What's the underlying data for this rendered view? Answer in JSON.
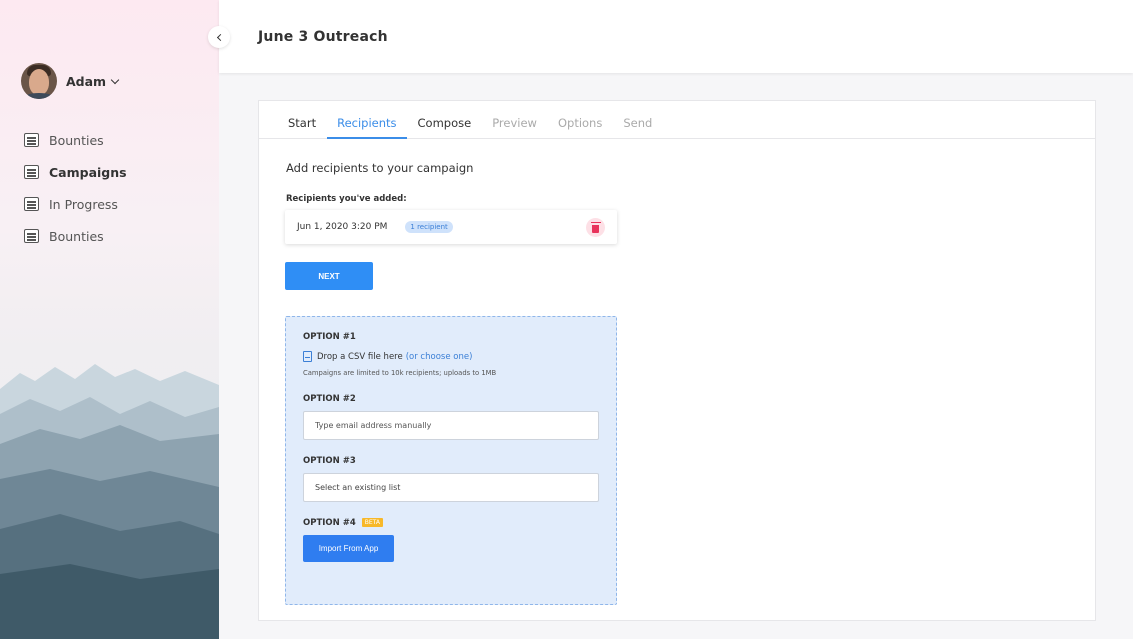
{
  "user": {
    "name": "Adam"
  },
  "sidebar": {
    "items": [
      {
        "label": "Bounties",
        "active": false
      },
      {
        "label": "Campaigns",
        "active": true
      },
      {
        "label": "In Progress",
        "active": false
      },
      {
        "label": "Bounties",
        "active": false
      }
    ]
  },
  "header": {
    "title": "June 3 Outreach"
  },
  "tabs": [
    {
      "label": "Start",
      "state": "normal"
    },
    {
      "label": "Recipients",
      "state": "active"
    },
    {
      "label": "Compose",
      "state": "normal"
    },
    {
      "label": "Preview",
      "state": "disabled"
    },
    {
      "label": "Options",
      "state": "disabled"
    },
    {
      "label": "Send",
      "state": "disabled"
    }
  ],
  "recipients": {
    "section_title": "Add recipients to your campaign",
    "added_label": "Recipients you've added:",
    "entry": {
      "date": "Jun 1, 2020 3:20 PM",
      "badge": "1 recipient"
    },
    "next_label": "NEXT"
  },
  "options": {
    "option1": {
      "label": "OPTION #1",
      "drop_text": "Drop a CSV file here",
      "choose_text": "(or choose one)",
      "note": "Campaigns are limited to 10k recipients; uploads to 1MB"
    },
    "option2": {
      "label": "OPTION #2",
      "placeholder": "Type email address manually"
    },
    "option3": {
      "label": "OPTION #3",
      "value": "Select an existing list"
    },
    "option4": {
      "label": "OPTION #4",
      "badge": "BETA",
      "button": "Import From App"
    }
  },
  "colors": {
    "accent": "#2f8ef5",
    "tab_active": "#3b8de8",
    "delete": "#e8335b",
    "beta": "#f7b829",
    "options_bg": "#e1ecfb"
  }
}
